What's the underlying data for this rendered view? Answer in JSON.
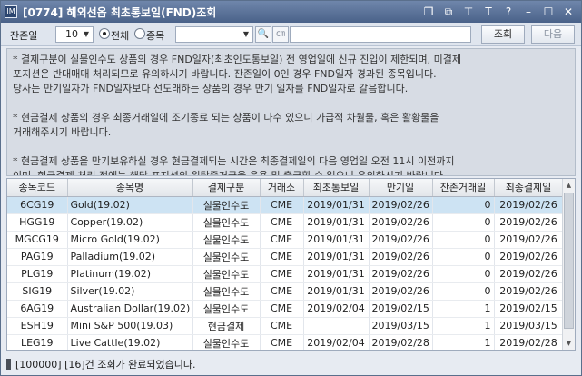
{
  "window": {
    "app_icon": "IM",
    "title": "[0774] 해외선옵 최초통보일(FND)조회",
    "icons": [
      "restore-icon",
      "copy-icon",
      "pin-icon",
      "font-icon",
      "help-icon",
      "minimize-icon",
      "maximize-icon",
      "close-icon"
    ],
    "icon_glyphs": [
      "❐",
      "⧉",
      "⊤",
      "T",
      "?",
      "–",
      "☐",
      "✕"
    ]
  },
  "toolbar": {
    "remaining_days_label": "잔존일",
    "remaining_days_value": "10",
    "radio_all_label": "전체",
    "radio_item_label": "종목",
    "selected_radio": "all",
    "search_glyph": "🔍",
    "code_glyph": "㎝",
    "query_button": "조회",
    "next_button": "다음"
  },
  "notice": {
    "lines": [
      "* 결제구분이 실물인수도 상품의 경우 FND일자(최초인도통보일) 전 영업일에 신규 진입이 제한되며, 미결제",
      "포지션은 반대매매 처리되므로 유의하시기 바랍니다. 잔존일이 0인 경우 FND일자 경과된 종목입니다.",
      "당사는 만기일자가 FND일자보다 선도래하는 상품의 경우 만기 일자를 FND일자로 갈음합니다.",
      "",
      "* 현금결제 상품의 경우 최종거래일에 조기종료 되는 상품이 다수 있으니 가급적 차월물, 혹은 활황물을",
      "거래해주시기 바랍니다.",
      "",
      "* 현금결제 상품을 만기보유하실 경우 현금결제되는 시간은 최종결제일의 다음 영업일 오전 11시 이전까지",
      "이며, 현금결제 처리 전에는  해당 포지션의 위탁증거금을 운용 및 출금할 수 없으니 유의하시기 바랍니다."
    ]
  },
  "table": {
    "headers": [
      "종목코드",
      "종목명",
      "결제구분",
      "거래소",
      "최초통보일",
      "만기일",
      "잔존거래일",
      "최종결제일"
    ],
    "rows": [
      [
        "6CG19",
        "Gold(19.02)",
        "실물인수도",
        "CME",
        "2019/01/31",
        "2019/02/26",
        "0",
        "2019/02/26"
      ],
      [
        "HGG19",
        "Copper(19.02)",
        "실물인수도",
        "CME",
        "2019/01/31",
        "2019/02/26",
        "0",
        "2019/02/26"
      ],
      [
        "MGCG19",
        "Micro Gold(19.02)",
        "실물인수도",
        "CME",
        "2019/01/31",
        "2019/02/26",
        "0",
        "2019/02/26"
      ],
      [
        "PAG19",
        "Palladium(19.02)",
        "실물인수도",
        "CME",
        "2019/01/31",
        "2019/02/26",
        "0",
        "2019/02/26"
      ],
      [
        "PLG19",
        "Platinum(19.02)",
        "실물인수도",
        "CME",
        "2019/01/31",
        "2019/02/26",
        "0",
        "2019/02/26"
      ],
      [
        "SIG19",
        "Silver(19.02)",
        "실물인수도",
        "CME",
        "2019/01/31",
        "2019/02/26",
        "0",
        "2019/02/26"
      ],
      [
        "6AG19",
        "Australian Dollar(19.02)",
        "실물인수도",
        "CME",
        "2019/02/04",
        "2019/02/15",
        "1",
        "2019/02/15"
      ],
      [
        "ESH19",
        "Mini S&P 500(19.03)",
        "현금결제",
        "CME",
        "",
        "2019/03/15",
        "1",
        "2019/03/15"
      ],
      [
        "LEG19",
        "Live Cattle(19.02)",
        "실물인수도",
        "CME",
        "2019/02/04",
        "2019/02/28",
        "1",
        "2019/02/28"
      ]
    ]
  },
  "status": {
    "text": "[100000] [16]건 조회가 완료되었습니다."
  }
}
